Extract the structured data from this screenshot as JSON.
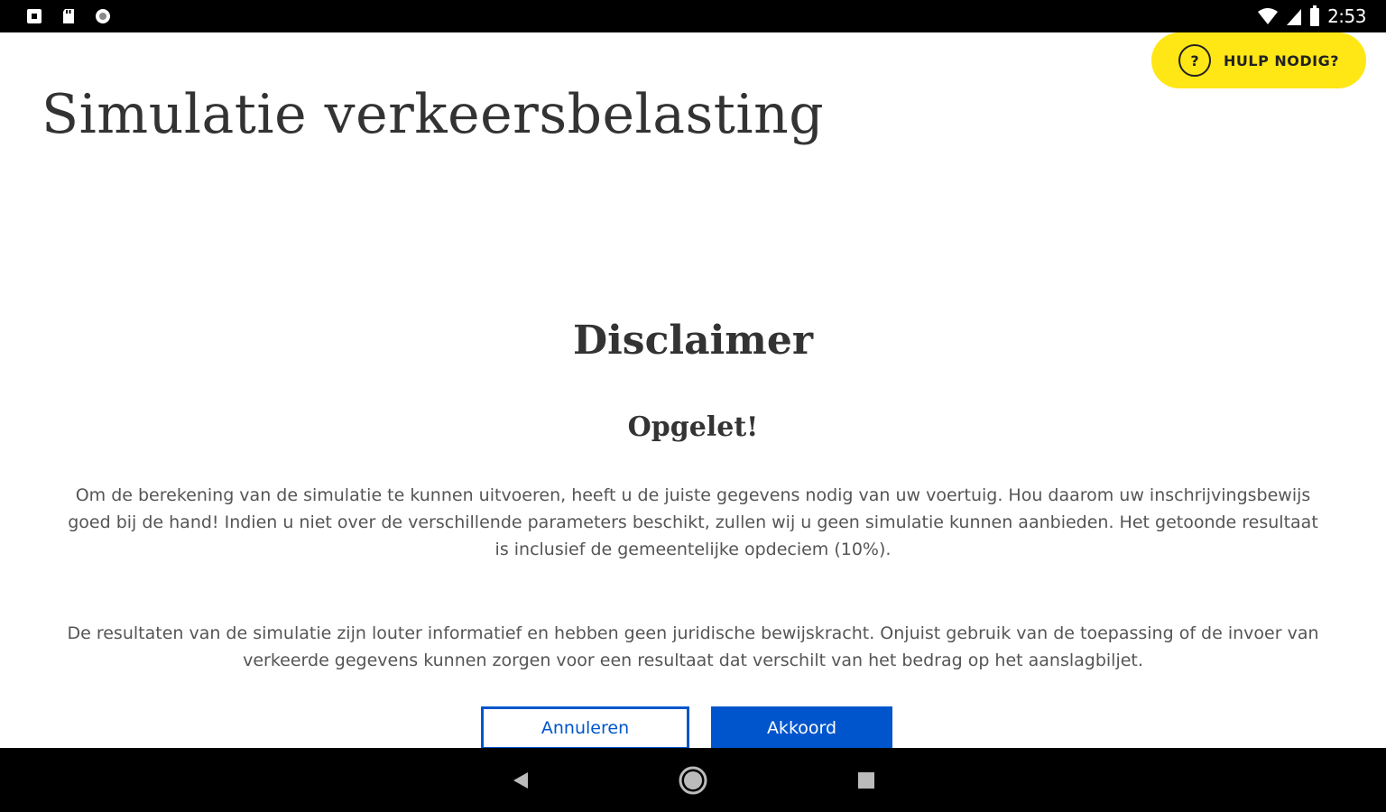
{
  "status_bar": {
    "time": "2:53",
    "left_icons": [
      "notification-icon",
      "sd-card-icon",
      "circle-icon"
    ],
    "right_icons": [
      "wifi-icon",
      "signal-icon",
      "battery-icon"
    ]
  },
  "help_button": {
    "icon_text": "?",
    "label": "HULP NODIG?",
    "color": "#ffe615"
  },
  "page": {
    "title": "Simulatie verkeersbelasting"
  },
  "disclaimer": {
    "title": "Disclaimer",
    "warning": "Opgelet!",
    "paragraph_1": "Om de berekening van de simulatie te kunnen uitvoeren, heeft u de juiste gegevens nodig van uw voertuig. Hou daarom uw inschrijvingsbewijs goed bij de hand! Indien u niet over de verschillende parameters beschikt, zullen wij u geen simulatie kunnen aanbieden. Het getoonde resultaat is inclusief de gemeentelijke opdeciem (10%).",
    "paragraph_2": "De resultaten van de simulatie zijn louter informatief en hebben geen juridische bewijskracht. Onjuist gebruik van de toepassing of de invoer van verkeerde gegevens kunnen zorgen voor een resultaat dat verschilt van het bedrag op het aanslagbiljet."
  },
  "buttons": {
    "cancel_label": "Annuleren",
    "accept_label": "Akkoord",
    "accent_color": "#0055cc"
  },
  "nav_bar": {
    "icons": [
      "back-icon",
      "home-icon",
      "recents-icon"
    ]
  }
}
